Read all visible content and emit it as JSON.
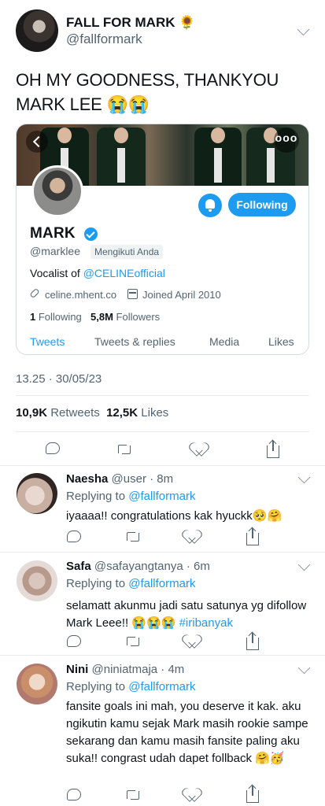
{
  "tweet": {
    "author_name": "FALL FOR MARK 🌻",
    "author_handle": "@fallformark",
    "text": "OH MY GOODNESS, THANKYOU MARK LEE 😭😭",
    "timestamp": "13.25 · 30/05/23",
    "retweets_count": "10,9K",
    "retweets_label": "Retweets",
    "likes_count": "12,5K",
    "likes_label": "Likes"
  },
  "profile_card": {
    "more_label": "ooo",
    "follow_button": "Following",
    "name": "MARK",
    "handle": "@marklee",
    "follows_you": "Mengikuti Anda",
    "bio_prefix": "Vocalist of ",
    "bio_link": "@CELINEofficial",
    "website": "celine.mhent.co",
    "joined": "Joined April 2010",
    "following_count": "1",
    "following_label": "Following",
    "followers_count": "5,8M",
    "followers_label": "Followers",
    "tabs": [
      "Tweets",
      "Tweets & replies",
      "Media",
      "Likes"
    ]
  },
  "replies": [
    {
      "name": "Naesha",
      "handle_time": "@user · 8m",
      "replying_prefix": "Replying to",
      "replying_to": "@fallformark",
      "text": "iyaaaa!! congratulations kak hyuckk🥺🤗"
    },
    {
      "name": "Safa",
      "handle_time": "@safayangtanya · 6m",
      "replying_prefix": "Replying to",
      "replying_to": "@fallformark",
      "text": "selamatt akunmu jadi satu satunya yg difollow Mark Leee!! 😭😭😭 ",
      "hashtag": "#iribanyak"
    },
    {
      "name": "Nini",
      "handle_time": "@niniatmaja · 4m",
      "replying_prefix": "Replying to",
      "replying_to": "@fallformark",
      "text": "fansite goals ini mah, you deserve it kak. aku ngikutin kamu sejak Mark masih rookie sampe sekarang dan kamu masih fansite paling aku suka!! congrast udah dapet follback 🤗🥳"
    }
  ],
  "icons": [
    "chevron-down-icon",
    "reply-icon",
    "retweet-icon",
    "like-icon",
    "share-icon",
    "verified-icon",
    "bell-icon",
    "link-icon",
    "calendar-icon",
    "back-icon",
    "more-icon"
  ],
  "colors": {
    "accent": "#1d9bf0",
    "secondary_text": "#536471",
    "divider": "#e7e9ea"
  }
}
